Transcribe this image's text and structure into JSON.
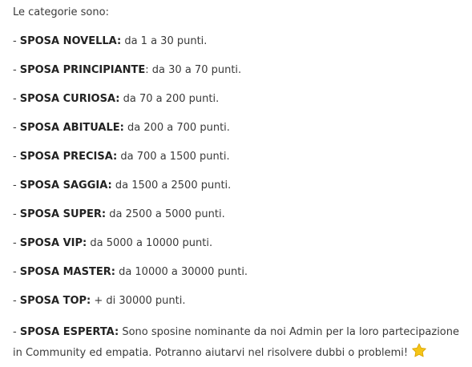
{
  "intro": "Le categorie sono:",
  "dash": "-",
  "categories": [
    {
      "name": "SPOSA NOVELLA:",
      "range": "da 1 a 30 punti."
    },
    {
      "name": "SPOSA PRINCIPIANTE",
      "range": ": da 30 a 70 punti."
    },
    {
      "name": "SPOSA CURIOSA:",
      "range": "da 70 a 200 punti."
    },
    {
      "name": "SPOSA ABITUALE:",
      "range": "da 200 a 700 punti."
    },
    {
      "name": "SPOSA PRECISA:",
      "range": "da 700 a 1500 punti."
    },
    {
      "name": "SPOSA SAGGIA:",
      "range": "da 1500 a 2500 punti."
    },
    {
      "name": "SPOSA SUPER:",
      "range": "da 2500 a 5000 punti."
    },
    {
      "name": "SPOSA VIP:",
      "range": "da 5000 a 10000 punti."
    },
    {
      "name": "SPOSA MASTER:",
      "range": "da 10000 a 30000 punti."
    },
    {
      "name": "SPOSA TOP:",
      "range": "+ di 30000 punti."
    }
  ],
  "esperta": {
    "name": "SPOSA ESPERTA:",
    "text": "Sono sposine nominante da noi Admin per la loro partecipazione in Community ed empatia. Potranno aiutarvi nel risolvere dubbi o problemi!",
    "icon": "star-icon",
    "icon_color": "#f5c518"
  }
}
